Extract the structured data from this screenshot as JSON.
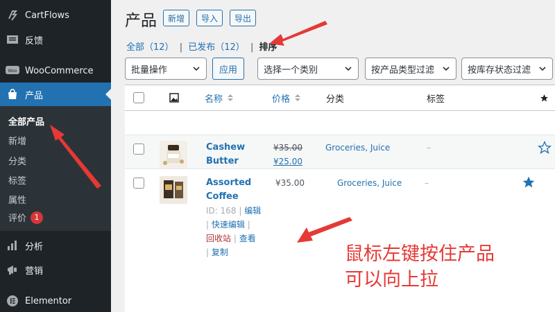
{
  "sidebar": {
    "items": [
      {
        "label": "CartFlows",
        "icon": "cartflows-icon"
      },
      {
        "label": "反馈",
        "icon": "feedback-icon"
      },
      {
        "label": "WooCommerce",
        "icon": "woo-icon"
      },
      {
        "label": "产品",
        "icon": "products-icon"
      },
      {
        "label": "分析",
        "icon": "analytics-icon"
      },
      {
        "label": "营销",
        "icon": "marketing-icon"
      },
      {
        "label": "Elementor",
        "icon": "elementor-icon"
      }
    ],
    "submenu": [
      {
        "label": "全部产品"
      },
      {
        "label": "新增"
      },
      {
        "label": "分类"
      },
      {
        "label": "标签"
      },
      {
        "label": "属性"
      },
      {
        "label": "评价",
        "badge": "1"
      }
    ]
  },
  "header": {
    "title": "产品",
    "buttons": [
      "新增",
      "导入",
      "导出"
    ]
  },
  "subsubsub": {
    "all_label": "全部",
    "all_count": "（12）",
    "published_label": "已发布",
    "published_count": "（12）",
    "sort_label": "排序"
  },
  "filters": {
    "bulk": "批量操作",
    "apply": "应用",
    "category": "选择一个类别",
    "type": "按产品类型过滤",
    "stock": "按库存状态过滤"
  },
  "table": {
    "columns": {
      "name": "名称",
      "price": "价格",
      "category": "分类",
      "tags": "标签"
    },
    "rows": [
      {
        "name_line1": "Cashew",
        "name_line2": "Butter",
        "regular_price": "¥35.00",
        "sale_price": "¥25.00",
        "categories": "Groceries, Juice",
        "tags": "–",
        "featured": false
      },
      {
        "name_line1": "Assorted",
        "name_line2": "Coffee",
        "price": "¥35.00",
        "categories": "Groceries, Juice",
        "tags": "–",
        "featured": true,
        "id_label": "ID: 168",
        "actions": {
          "edit": "编辑",
          "quick_edit": "快速编辑",
          "trash": "回收站",
          "view": "查看",
          "duplicate": "复制"
        }
      }
    ]
  },
  "annotation": {
    "line1": "鼠标左键按住产品",
    "line2": "可以向上拉"
  },
  "colors": {
    "accent": "#2271b1",
    "sidebar_bg": "#1d2327",
    "annotation_red": "#e53935"
  }
}
